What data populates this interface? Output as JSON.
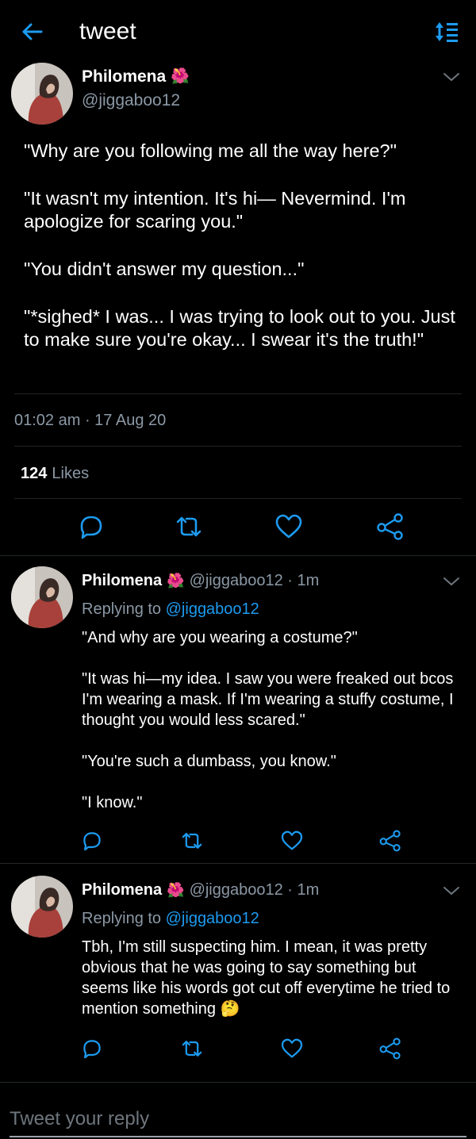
{
  "header": {
    "title": "tweet",
    "back_icon": "arrow-left-icon",
    "sort_icon": "sort-arrows-icon",
    "accent": "#1d9bf0"
  },
  "main_tweet": {
    "name": "Philomena",
    "name_emoji": "🌺",
    "handle": "@jiggaboo12",
    "paragraphs": [
      "\"Why are you following me all the way here?\"",
      "\"It wasn't my intention. It's hi— Nevermind. I'm apologize for scaring you.\"",
      "\"You didn't answer my question...\"",
      "\"*sighed* I was... I was trying to look out to you. Just to make sure you're okay... I swear it's the truth!\""
    ],
    "timestamp": "01:02 am · 17 Aug 20",
    "likes_count": "124",
    "likes_label": "Likes"
  },
  "replies": [
    {
      "name": "Philomena",
      "name_emoji": "🌺",
      "meta": "@jiggaboo12 · 1m",
      "replying_label": "Replying to",
      "replying_handle": "@jiggaboo12",
      "paragraphs": [
        "\"And why are you wearing a costume?\"",
        "\"It was hi—my idea. I saw you were freaked out bcos I'm wearing a mask. If I'm wearing a stuffy costume, I thought you would less scared.\"",
        "\"You're such a dumbass, you know.\"",
        "\"I know.\""
      ]
    },
    {
      "name": "Philomena",
      "name_emoji": "🌺",
      "meta": "@jiggaboo12 · 1m",
      "replying_label": "Replying to",
      "replying_handle": "@jiggaboo12",
      "paragraphs": [
        "Tbh, I'm still suspecting him. I mean, it was pretty obvious that he was going to say something but seems like his words got cut off everytime he tried to mention something"
      ],
      "trailing_emoji": "🤔"
    }
  ],
  "composer": {
    "placeholder": "Tweet your reply"
  }
}
